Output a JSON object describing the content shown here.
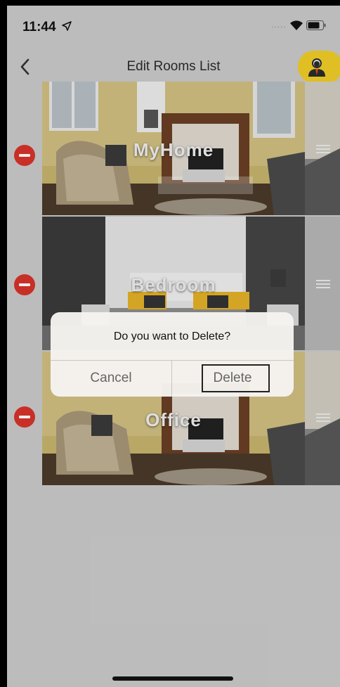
{
  "status_bar": {
    "time": "11:44",
    "icons": [
      "location-arrow-icon",
      "signal-dots-icon",
      "wifi-icon",
      "battery-icon"
    ]
  },
  "nav": {
    "title": "Edit Rooms List",
    "back_icon": "chevron-left-icon",
    "avatar_icon": "person-icon",
    "avatar_color": "#f2d027"
  },
  "rooms": [
    {
      "name": "MyHome",
      "scene": "living-room"
    },
    {
      "name": "Bedroom",
      "scene": "bedroom"
    },
    {
      "name": "Office",
      "scene": "living-room"
    }
  ],
  "colors": {
    "delete": "#d9342b",
    "background": "#cdcdcd"
  },
  "alert": {
    "message": "Do you want to Delete?",
    "cancel_label": "Cancel",
    "delete_label": "Delete"
  }
}
